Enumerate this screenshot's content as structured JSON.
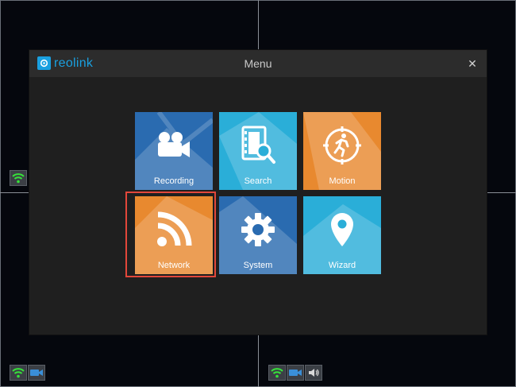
{
  "colors": {
    "tile_blue": "#2a6bb0",
    "tile_cyan": "#2aaed8",
    "tile_orange": "#e8892f",
    "focus_red": "#e2473a",
    "brand": "#1aa0e0",
    "status_green": "#36e23a"
  },
  "menu": {
    "logo_text": "reolink",
    "title": "Menu",
    "close_symbol": "✕",
    "tiles": [
      {
        "label": "Recording",
        "icon": "camera-icon"
      },
      {
        "label": "Search",
        "icon": "film-search-icon"
      },
      {
        "label": "Motion",
        "icon": "motion-icon"
      },
      {
        "label": "Network",
        "icon": "rss-network-icon",
        "selected": true
      },
      {
        "label": "System",
        "icon": "gear-icon"
      },
      {
        "label": "Wizard",
        "icon": "location-pin-icon"
      }
    ]
  },
  "status_icons": [
    {
      "icon": "wifi-icon"
    },
    {
      "icon": "wifi-icon"
    },
    {
      "icon": "video-camera-icon"
    },
    {
      "icon": "wifi-icon"
    },
    {
      "icon": "video-camera-icon"
    },
    {
      "icon": "speaker-icon"
    }
  ]
}
